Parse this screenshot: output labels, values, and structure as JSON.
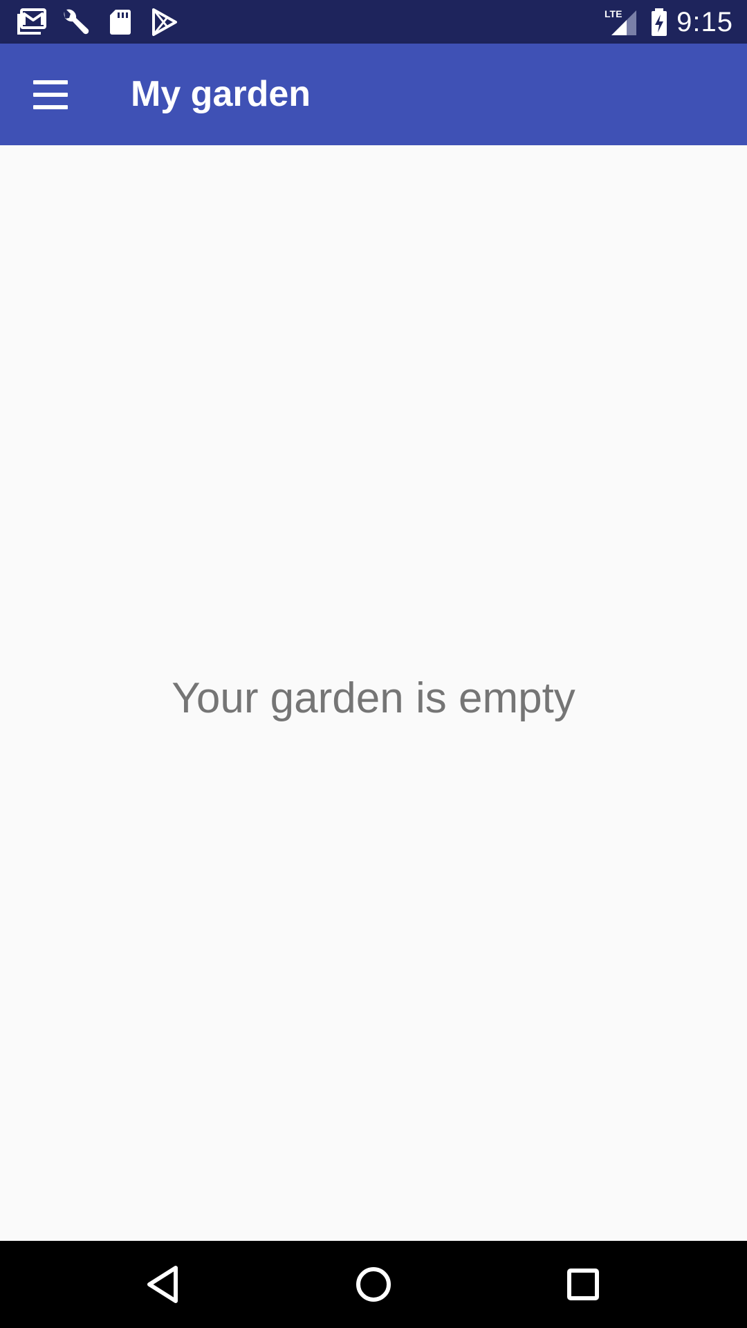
{
  "status_bar": {
    "time": "9:15",
    "left_icons": [
      "gmail-icon",
      "wrench-icon",
      "sd-card-icon",
      "play-store-icon"
    ],
    "right_icons": [
      "lte-signal-icon",
      "battery-charging-icon"
    ],
    "network_label": "LTE",
    "background_color": "#1e245c"
  },
  "app_bar": {
    "title": "My garden",
    "menu_icon": "hamburger-menu-icon",
    "background_color": "#3f51b5"
  },
  "main": {
    "empty_message": "Your garden is empty",
    "background_color": "#fafafa",
    "text_color": "#757575"
  },
  "nav_bar": {
    "buttons": [
      "back-icon",
      "home-icon",
      "recents-icon"
    ]
  }
}
